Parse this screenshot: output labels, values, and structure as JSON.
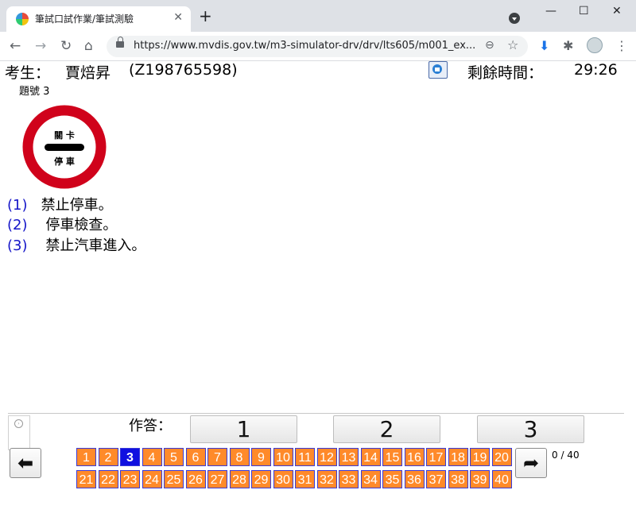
{
  "browser": {
    "tab_title": "筆試口試作業/筆試測驗",
    "tab_close": "✕",
    "new_tab": "+",
    "window_min": "—",
    "window_max": "☐",
    "window_close": "✕",
    "url": "https://www.mvdis.gov.tw/m3-simulator-drv/drv/lts605/m001_ex...",
    "nav_back": "←",
    "nav_forward": "→",
    "nav_reload": "↻",
    "nav_home": "⌂",
    "zoom": "⊖",
    "star": "☆",
    "download": "⬇",
    "extensions": "✱",
    "menu": "⋮"
  },
  "header": {
    "candidate_label": "考生：",
    "candidate_name": "賈焙昇",
    "candidate_id": "(Z198765598)",
    "time_label": "剩餘時間：",
    "time_value": "29:26"
  },
  "question": {
    "number_label": "題號 3",
    "sign": {
      "top_text": "關 卡",
      "bottom_text": "停 車",
      "ring_color": "#d0021b",
      "bar_color": "#000000"
    },
    "options": [
      {
        "num": "(1)",
        "text": "禁止停車。"
      },
      {
        "num": "(2)",
        "text": "停車檢查。"
      },
      {
        "num": "(3)",
        "text": "禁止汽車進入。"
      }
    ]
  },
  "answer": {
    "label": "作答：",
    "buttons": [
      "1",
      "2",
      "3"
    ]
  },
  "navigation": {
    "prev_arrow": "⬅",
    "next_arrow": "➦",
    "progress": "0 / 40",
    "current_question": 3,
    "questions": [
      "1",
      "2",
      "3",
      "4",
      "5",
      "6",
      "7",
      "8",
      "9",
      "10",
      "11",
      "12",
      "13",
      "14",
      "15",
      "16",
      "17",
      "18",
      "19",
      "20",
      "21",
      "22",
      "23",
      "24",
      "25",
      "26",
      "27",
      "28",
      "29",
      "30",
      "31",
      "32",
      "33",
      "34",
      "35",
      "36",
      "37",
      "38",
      "39",
      "40"
    ],
    "cell_color": "#ff8a2a",
    "current_color": "#1010e0"
  }
}
